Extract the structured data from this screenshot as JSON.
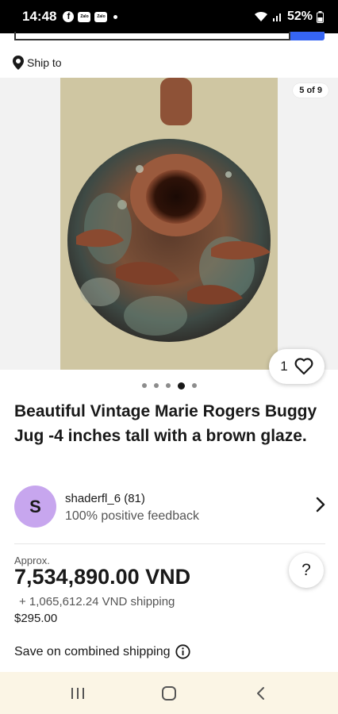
{
  "status_bar": {
    "time": "14:48",
    "zalo_label": "Zalo",
    "battery": "52%"
  },
  "ship_to": {
    "label": "Ship to"
  },
  "gallery": {
    "counter": "5 of 9",
    "watch_count": "1",
    "current_index": 4,
    "total_dots": 5
  },
  "item": {
    "title": "Beautiful Vintage Marie Rogers Buggy Jug -4 inches tall with a brown glaze."
  },
  "seller": {
    "initial": "S",
    "name": "shaderfl_6 (81)",
    "feedback": "100% positive feedback",
    "avatar_color": "#c7a6ee"
  },
  "price": {
    "approx_label": "Approx.",
    "amount": "7,534,890.00 VND",
    "shipping": "+ 1,065,612.24 VND shipping",
    "usd": "$295.00",
    "help": "?"
  },
  "combined_shipping": {
    "label": "Save on combined shipping"
  },
  "colors": {
    "accent": "#3665f3",
    "nav_bg": "#fbf5e5"
  }
}
